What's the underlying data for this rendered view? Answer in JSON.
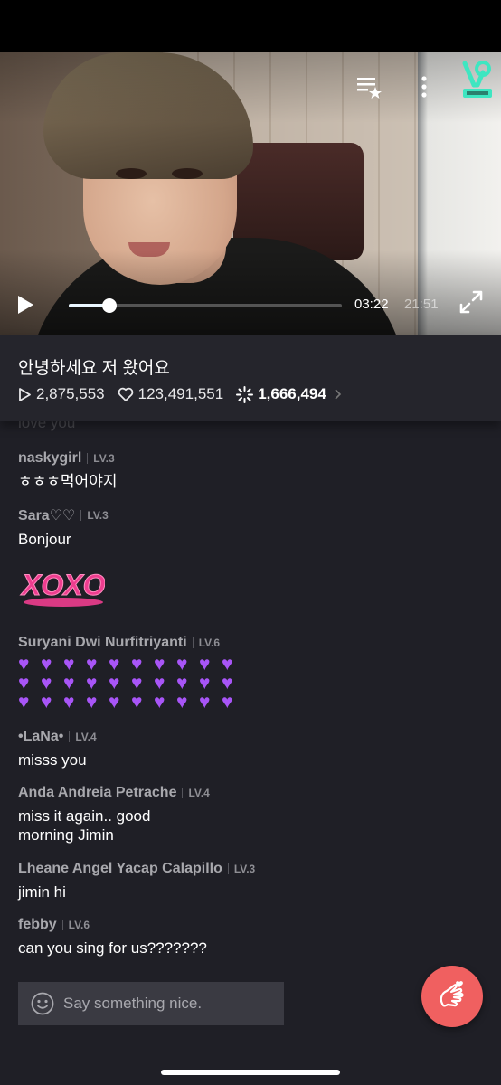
{
  "player": {
    "current_time": "03:22",
    "total_time": "21:51",
    "progress": 0.15
  },
  "video": {
    "title": "안녕하세요 저 왔어요",
    "plays": "2,875,553",
    "likes": "123,491,551",
    "comments_count": "1,666,494"
  },
  "chat": {
    "faded_top": "love you",
    "comments": [
      {
        "user": "naskygirl",
        "level": "LV.3",
        "text": "ㅎㅎㅎ먹어야지"
      },
      {
        "user": "Sara♡♡",
        "level": "LV.3",
        "text": "Bonjour",
        "sticker": "XOXO"
      },
      {
        "user": "Suryani Dwi Nurfitriyanti",
        "level": "LV.6",
        "text": "💜💜💜💜💜💜💜💜💜💜💜💜💜💜💜💜💜💜💜💜💜💜💜💜💜💜💜💜💜💜"
      },
      {
        "user": "•LaNa•",
        "level": "LV.4",
        "text": "misss you"
      },
      {
        "user": "Anda Andreia Petrache",
        "level": "LV.4",
        "text": "miss it again.. good morning Jimin"
      },
      {
        "user": "Lheane Angel Yacap Calapillo",
        "level": "LV.3",
        "text": "jimin hi"
      },
      {
        "user": "febby",
        "level": "LV.6",
        "text": "can you sing for us???????"
      }
    ]
  },
  "input": {
    "placeholder": "Say something nice."
  },
  "colors": {
    "background": "#1f1f26",
    "accent_button": "#f06060",
    "heart": "#a855f7",
    "sticker": "#ee3d8f"
  },
  "icons": [
    "playlist-icon",
    "more-icon",
    "vlive-logo",
    "play-icon",
    "fullscreen-icon",
    "play-count-icon",
    "like-icon",
    "comment-count-icon",
    "smile-icon",
    "finger-heart-icon"
  ]
}
